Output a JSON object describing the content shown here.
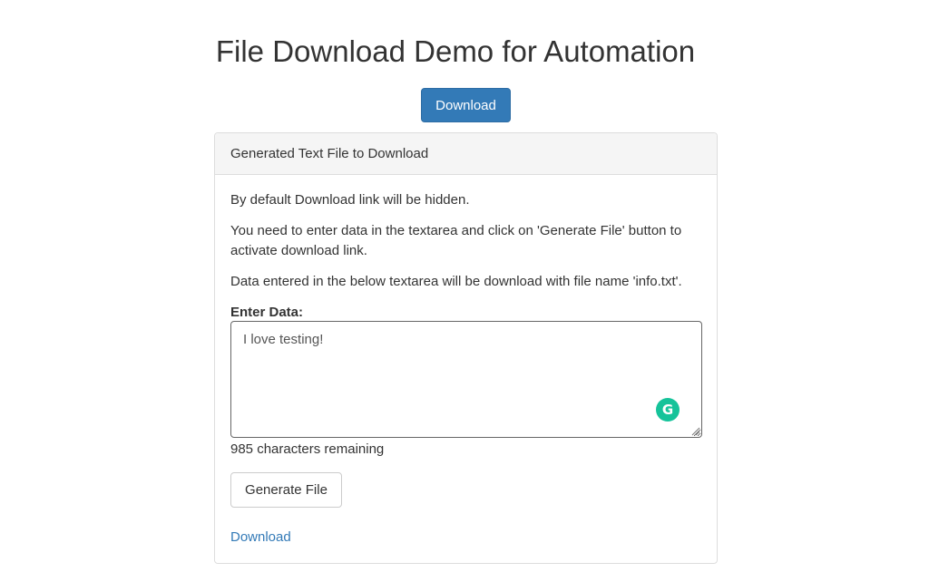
{
  "page": {
    "title": "File Download Demo for Automation"
  },
  "top_button": {
    "label": "Download",
    "color": "#337ab7"
  },
  "panel": {
    "heading": "Generated Text File to Download",
    "paragraphs": [
      "By default Download link will be hidden.",
      "You need to enter data in the textarea and click on 'Generate File' button to activate download link.",
      "Data entered in the below textarea will be download with file name 'info.txt'."
    ],
    "field_label": "Enter Data:",
    "textarea_value": "I love testing!",
    "characters_remaining": "985 characters remaining",
    "generate_button": "Generate File",
    "download_link": "Download",
    "grammarly_icon": "grammarly-icon",
    "grammarly_color": "#15c39a",
    "link_color": "#337ab7"
  }
}
